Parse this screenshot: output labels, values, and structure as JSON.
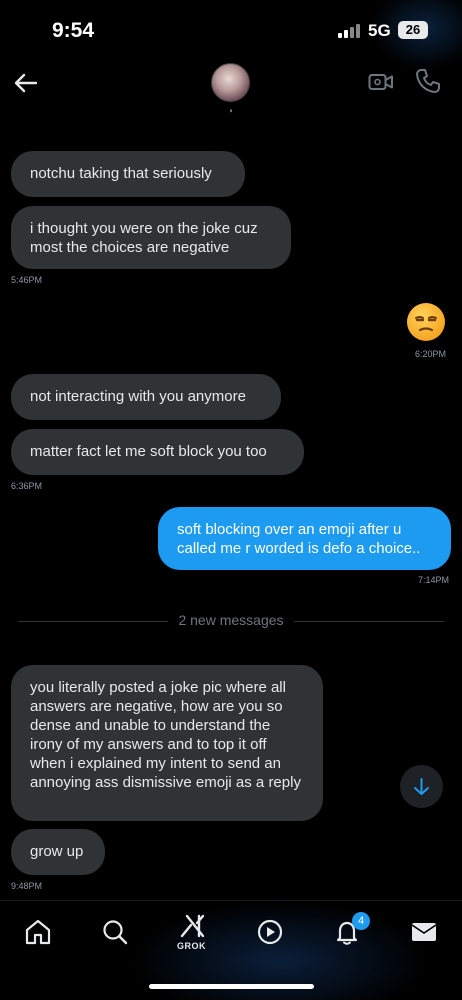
{
  "status_bar": {
    "time": "9:54",
    "network": "5G",
    "battery": "26"
  },
  "header": {
    "contact_name": "'"
  },
  "messages": [
    {
      "text": "notchu taking that seriously"
    },
    {
      "text": "i thought you were on the joke cuz most the choices are negative",
      "time": "5:46PM"
    },
    {
      "emoji": "unamused-face",
      "time": "6:20PM"
    },
    {
      "text": "not interacting with you anymore"
    },
    {
      "text": "matter fact let me soft block you too",
      "time": "6:36PM"
    },
    {
      "text": "soft blocking over an emoji after u called me r worded is defo a choice..",
      "time": "7:14PM"
    },
    {
      "text": "you literally posted a joke pic where all answers are negative, how are you so dense and unable to understand the irony of my answers and to top it off when i explained my intent to send an annoying ass dismissive emoji as a reply"
    },
    {
      "text": "grow up",
      "time": "9:48PM"
    }
  ],
  "divider": {
    "label": "2 new messages"
  },
  "nav": {
    "items": [
      "home-icon",
      "search-icon",
      "grok-icon",
      "play-icon",
      "bell-icon",
      "mail-icon"
    ],
    "grok_label": "GROK",
    "notifications_badge": "4"
  },
  "colors": {
    "outgoing_bubble": "#1d9bf0",
    "incoming_bubble": "#2f3336",
    "background": "#000000"
  }
}
